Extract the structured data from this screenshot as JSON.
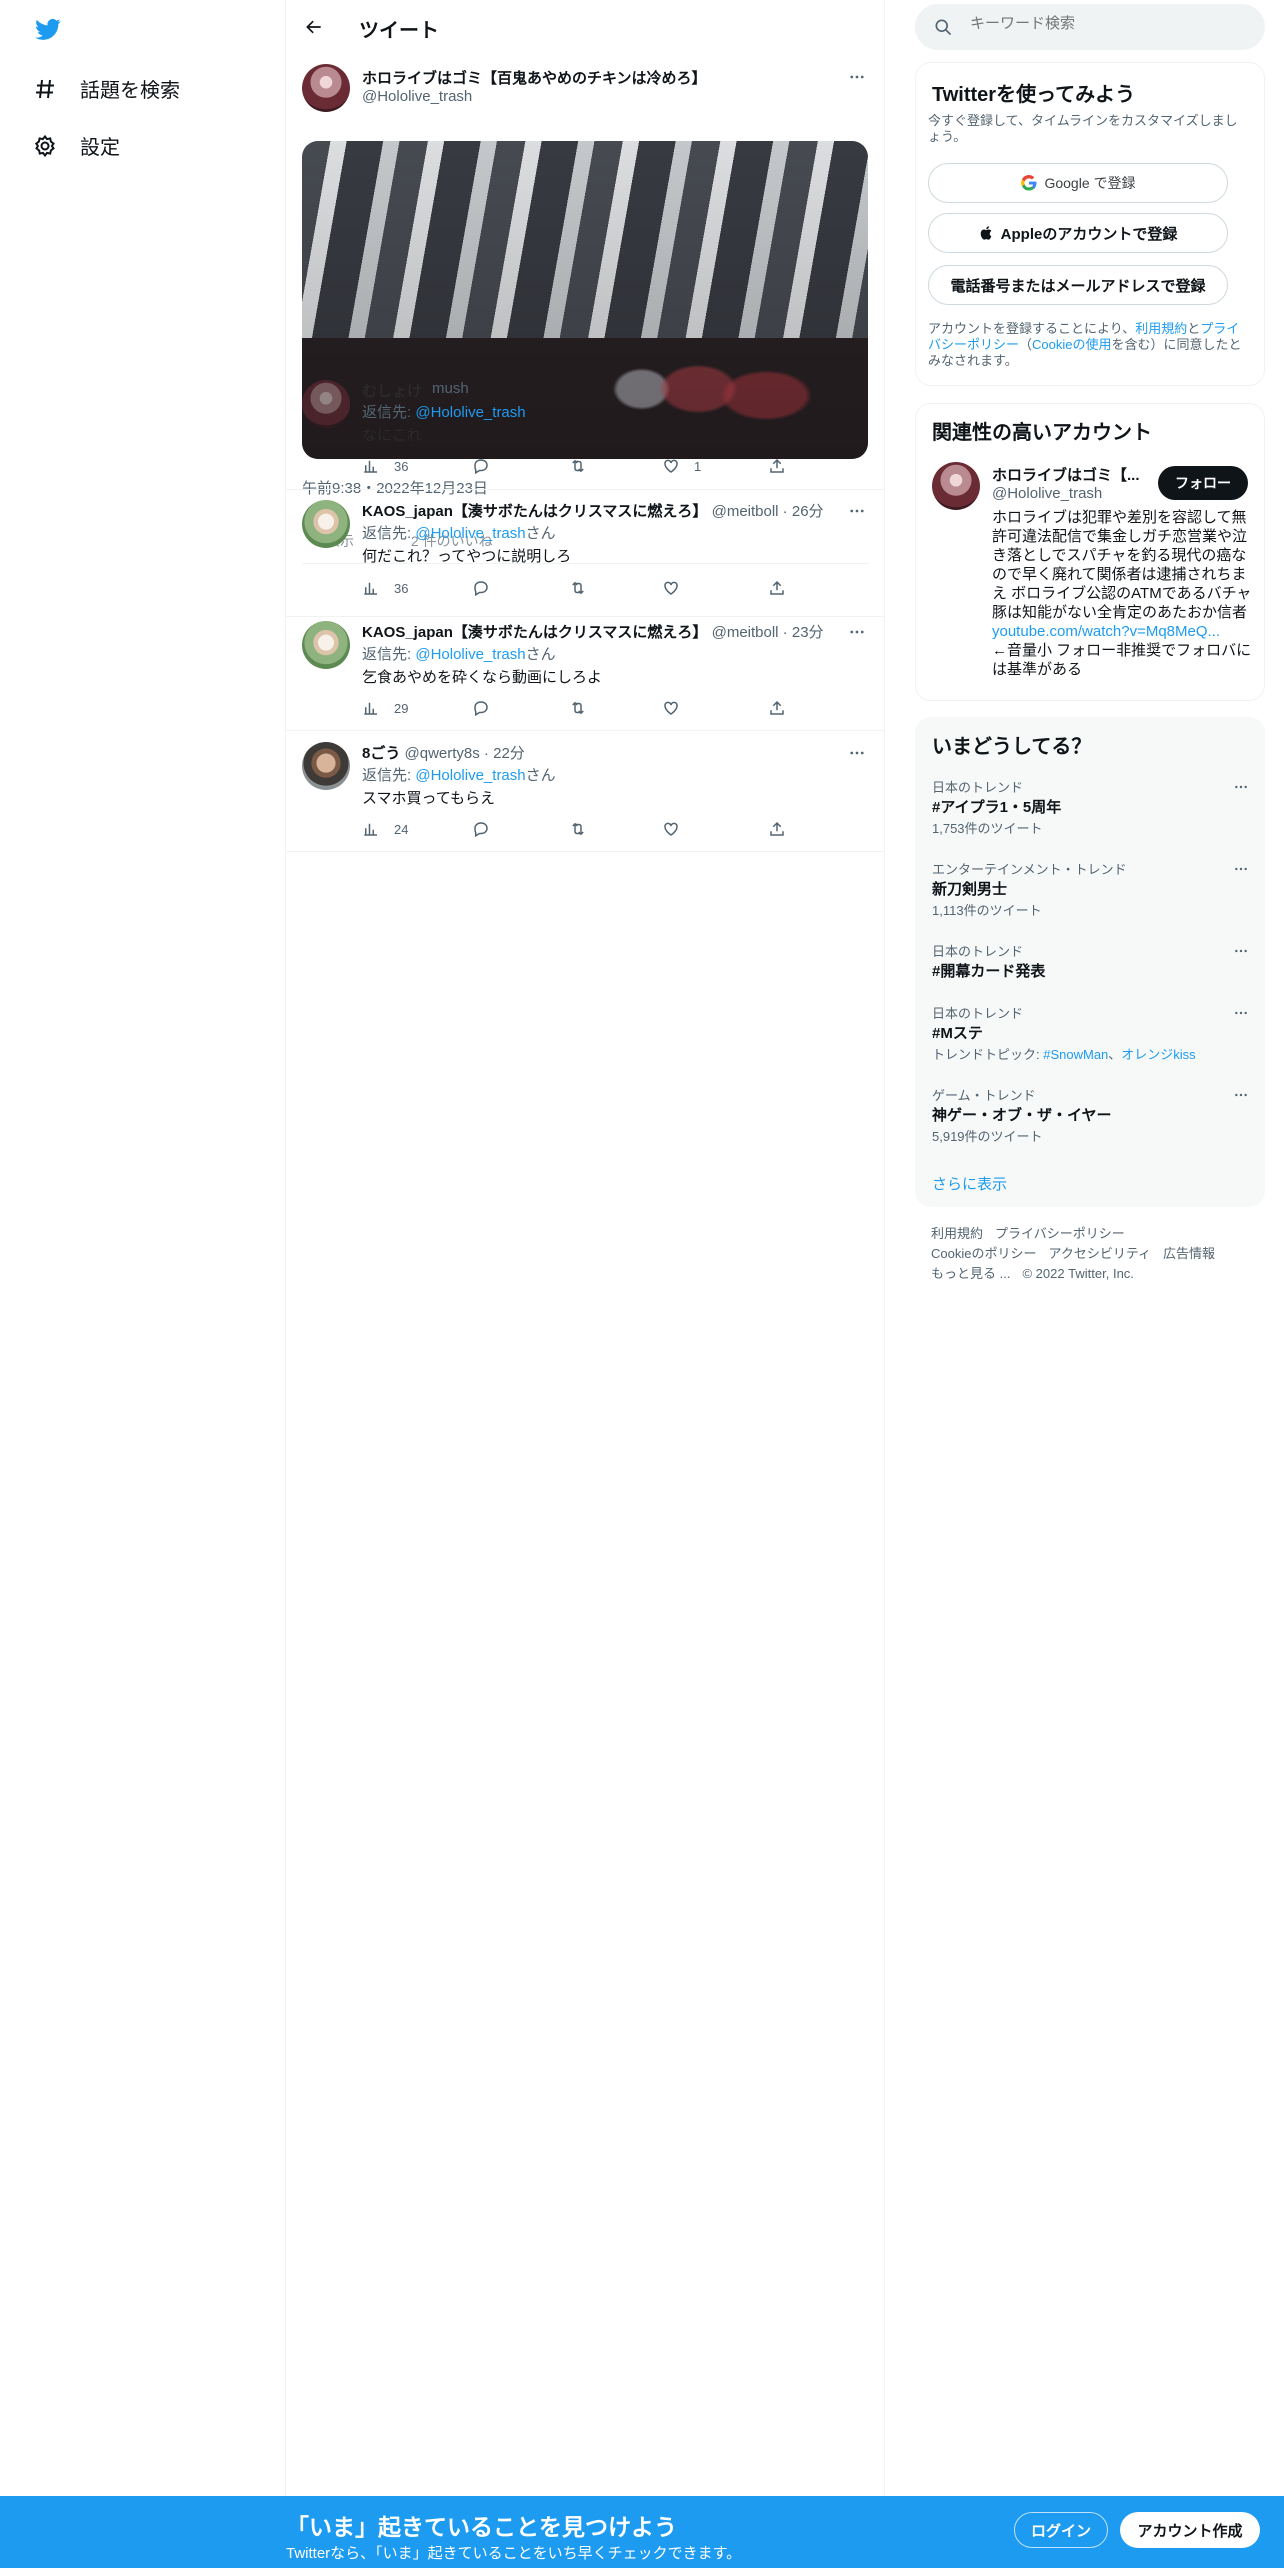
{
  "nav": {
    "explore_label": "話題を検索",
    "settings_label": "設定"
  },
  "header": {
    "title": "ツイート"
  },
  "main_tweet": {
    "name": "ホロライブはゴミ【百鬼あやめのチキンは冷めろ】",
    "handle": "@Hololive_trash",
    "timestamp": "午前9:38・2022年12月23日"
  },
  "embedded_reply": {
    "name": "むしょけ",
    "handle_suffix": "mush",
    "to_prefix": "返信先:",
    "to_handle": "@Hololive_trash",
    "text": "なにこれ",
    "views": "36",
    "likes": "1"
  },
  "ghost_text": {
    "show_label": "の表示",
    "count_label": "2 件のいいね"
  },
  "replies": [
    {
      "name": "KAOS_japan【湊サボたんはクリスマスに燃えろ】",
      "handle": "@meitboll",
      "time": "26分",
      "to_prefix": "返信先:",
      "to_handle": "@Hololive_trash",
      "to_suffix": "さん",
      "text": "何だこれ？ってやつに説明しろ",
      "views": "36"
    },
    {
      "name": "KAOS_japan【湊サボたんはクリスマスに燃えろ】",
      "handle": "@meitboll",
      "time": "23分",
      "to_prefix": "返信先:",
      "to_handle": "@Hololive_trash",
      "to_suffix": "さん",
      "text": "乞食あやめを砕くなら動画にしろよ",
      "views": "29"
    },
    {
      "name": "8ごう",
      "handle": "@qwerty8s",
      "time": "22分",
      "to_prefix": "返信先:",
      "to_handle": "@Hololive_trash",
      "to_suffix": "さん",
      "text": "スマホ買ってもらえ",
      "views": "24"
    }
  ],
  "search": {
    "placeholder": "キーワード検索"
  },
  "signup_card": {
    "title": "Twitterを使ってみよう",
    "subtitle": "今すぐ登録して、タイムラインをカスタマイズしましょう。",
    "google": "Google で登録",
    "apple": "Appleのアカウントで登録",
    "phone": "電話番号またはメールアドレスで登録",
    "legal_prefix": "アカウントを登録することにより、",
    "terms": "利用規約",
    "and": "と",
    "privacy": "プライバシーポリシー",
    "cookie_open": "（",
    "cookie": "Cookieの使用",
    "legal_suffix": "を含む）に同意したとみなされます。"
  },
  "related": {
    "title": "関連性の高いアカウント",
    "name": "ホロライブはゴミ【...",
    "handle": "@Hololive_trash",
    "follow": "フォロー",
    "bio_a": "ホロライブは犯罪や差別を容認して無許可違法配信で集金しガチ恋営業や泣き落としでスパチャを釣る現代の癌なので早く廃れて関係者は逮捕されちまえ ボロライブ公認のATMであるバチャ豚は知能がない全肯定のあたおか信者 ",
    "bio_link": "youtube.com/watch?v=Mq8MeQ...",
    "bio_b": "←音量小 フォロー非推奨でフォロバには基準がある"
  },
  "trends": {
    "title": "いまどうしてる？",
    "items": [
      {
        "category": "日本のトレンド",
        "name": "#アイプラ1・5周年",
        "count": "1,753件のツイート"
      },
      {
        "category": "エンターテインメント・トレンド",
        "name": "新刀剣男士",
        "count": "1,113件のツイート"
      },
      {
        "category": "日本のトレンド",
        "name": "#開幕カード発表",
        "count": ""
      },
      {
        "category": "日本のトレンド",
        "name": "#Mステ",
        "topic_prefix": "トレンドトピック: ",
        "topic_a": "#SnowMan",
        "topic_sep": "、",
        "topic_b": "オレンジkiss"
      },
      {
        "category": "ゲーム・トレンド",
        "name": "神ゲー・オブ・ザ・イヤー",
        "count": "5,919件のツイート"
      }
    ],
    "show_more": "さらに表示"
  },
  "footer": {
    "terms": "利用規約",
    "privacy": "プライバシーポリシー",
    "cookie": "Cookieのポリシー",
    "accessibility": "アクセシビリティ",
    "ads": "広告情報",
    "more": "もっと見る ...",
    "copyright": "© 2022 Twitter, Inc."
  },
  "bottom_bar": {
    "title": "「いま」起きていることを見つけよう",
    "subtitle": "Twitterなら、「いま」起きていることをいち早くチェックできます。",
    "login": "ログイン",
    "signup": "アカウント作成"
  },
  "colors": {
    "accent": "#1d9bf0",
    "text": "#0f1419",
    "muted": "#536471"
  }
}
